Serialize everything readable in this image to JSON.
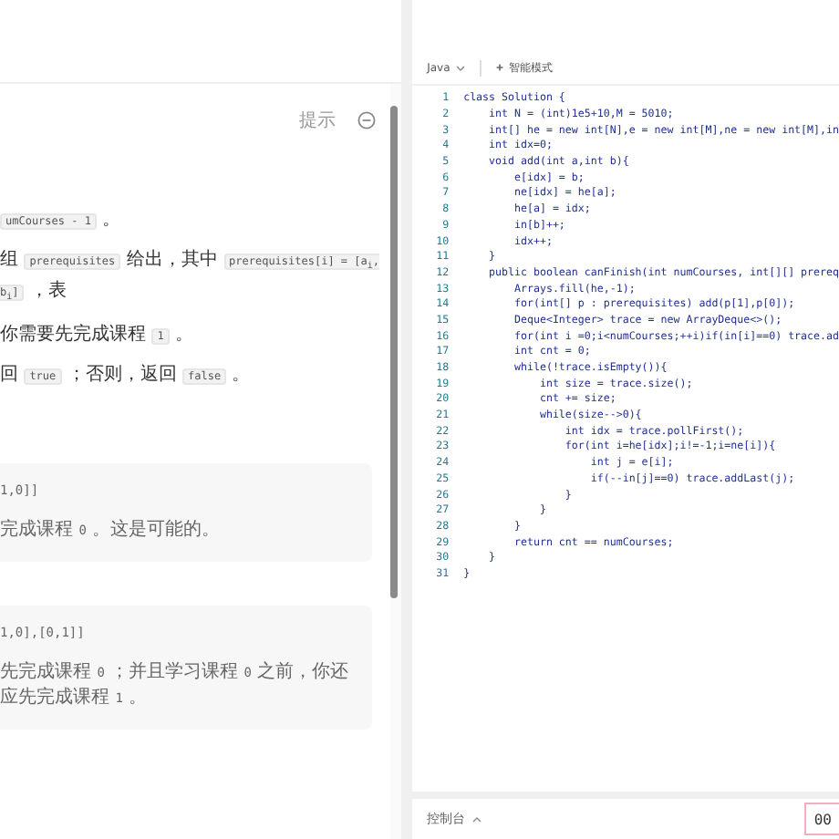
{
  "description_panel": {
    "hint_label": "提示",
    "paragraphs": [
      [
        {
          "kind": "code",
          "text": "umCourses - 1"
        },
        {
          "kind": "text",
          "text": " 。"
        }
      ],
      [
        {
          "kind": "text",
          "text": "组 "
        },
        {
          "kind": "code",
          "text": "prerequisites"
        },
        {
          "kind": "text",
          "text": " 给出，其中 "
        },
        {
          "kind": "code",
          "text": "prerequisites[i] = [a$_{i}$, b$_{i}$]"
        },
        {
          "kind": "text",
          "text": " ，表"
        }
      ],
      [
        {
          "kind": "text",
          "text": "你需要先完成课程 "
        },
        {
          "kind": "code",
          "text": "1"
        },
        {
          "kind": "text",
          "text": " 。"
        }
      ],
      [
        {
          "kind": "text",
          "text": "回 "
        },
        {
          "kind": "code",
          "text": "true"
        },
        {
          "kind": "text",
          "text": " ；否则，返回 "
        },
        {
          "kind": "code",
          "text": "false"
        },
        {
          "kind": "text",
          "text": " 。"
        }
      ]
    ],
    "examples": [
      {
        "lines": [
          [
            {
              "kind": "code",
              "text": "1,0]]"
            }
          ],
          [
            {
              "kind": "text",
              "text": "完成课程 "
            },
            {
              "kind": "code",
              "text": "0"
            },
            {
              "kind": "text",
              "text": " 。这是可能的。"
            }
          ]
        ]
      },
      {
        "lines": [
          [
            {
              "kind": "code",
              "text": "1,0],[0,1]]"
            }
          ],
          [
            {
              "kind": "text",
              "text": "先完成课程 "
            },
            {
              "kind": "code",
              "text": "0"
            },
            {
              "kind": "text",
              "text": " ；并且学习课程 "
            },
            {
              "kind": "code",
              "text": "0"
            },
            {
              "kind": "text",
              "text": " 之前，你还应先完成课程 "
            },
            {
              "kind": "code",
              "text": "1"
            },
            {
              "kind": "text",
              "text": " 。"
            }
          ]
        ]
      }
    ]
  },
  "editor": {
    "language": "Java",
    "mode": "智能模式",
    "lines": [
      {
        "number": "1",
        "code": "class Solution {"
      },
      {
        "number": "2",
        "code": "    int N = (int)1e5+10,M = 5010;"
      },
      {
        "number": "3",
        "code": "    int[] he = new int[N],e = new int[M],ne = new int[M],in"
      },
      {
        "number": "4",
        "code": "    int idx=0;"
      },
      {
        "number": "5",
        "code": "    void add(int a,int b){"
      },
      {
        "number": "6",
        "code": "        e[idx] = b;"
      },
      {
        "number": "7",
        "code": "        ne[idx] = he[a];"
      },
      {
        "number": "8",
        "code": "        he[a] = idx;"
      },
      {
        "number": "9",
        "code": "        in[b]++;"
      },
      {
        "number": "10",
        "code": "        idx++;"
      },
      {
        "number": "11",
        "code": "    }"
      },
      {
        "number": "12",
        "code": "    public boolean canFinish(int numCourses, int[][] prereq"
      },
      {
        "number": "13",
        "code": "        Arrays.fill(he,-1);"
      },
      {
        "number": "14",
        "code": "        for(int[] p : prerequisites) add(p[1],p[0]);"
      },
      {
        "number": "15",
        "code": "        Deque<Integer> trace = new ArrayDeque<>();"
      },
      {
        "number": "16",
        "code": "        for(int i =0;i<numCourses;++i)if(in[i]==0) trace.ad"
      },
      {
        "number": "17",
        "code": "        int cnt = 0;"
      },
      {
        "number": "18",
        "code": "        while(!trace.isEmpty()){"
      },
      {
        "number": "19",
        "code": "            int size = trace.size();"
      },
      {
        "number": "20",
        "code": "            cnt += size;"
      },
      {
        "number": "21",
        "code": "            while(size-->0){"
      },
      {
        "number": "22",
        "code": "                int idx = trace.pollFirst();"
      },
      {
        "number": "23",
        "code": "                for(int i=he[idx];i!=-1;i=ne[i]){"
      },
      {
        "number": "24",
        "code": "                    int j = e[i];"
      },
      {
        "number": "25",
        "code": "                    if(--in[j]==0) trace.addLast(j);"
      },
      {
        "number": "26",
        "code": "                }"
      },
      {
        "number": "27",
        "code": "            }"
      },
      {
        "number": "28",
        "code": "        }"
      },
      {
        "number": "29",
        "code": "        return cnt == numCourses;"
      },
      {
        "number": "30",
        "code": "    }"
      },
      {
        "number": "31",
        "code": "}"
      }
    ]
  },
  "console": {
    "label": "控制台",
    "timer": "00"
  }
}
